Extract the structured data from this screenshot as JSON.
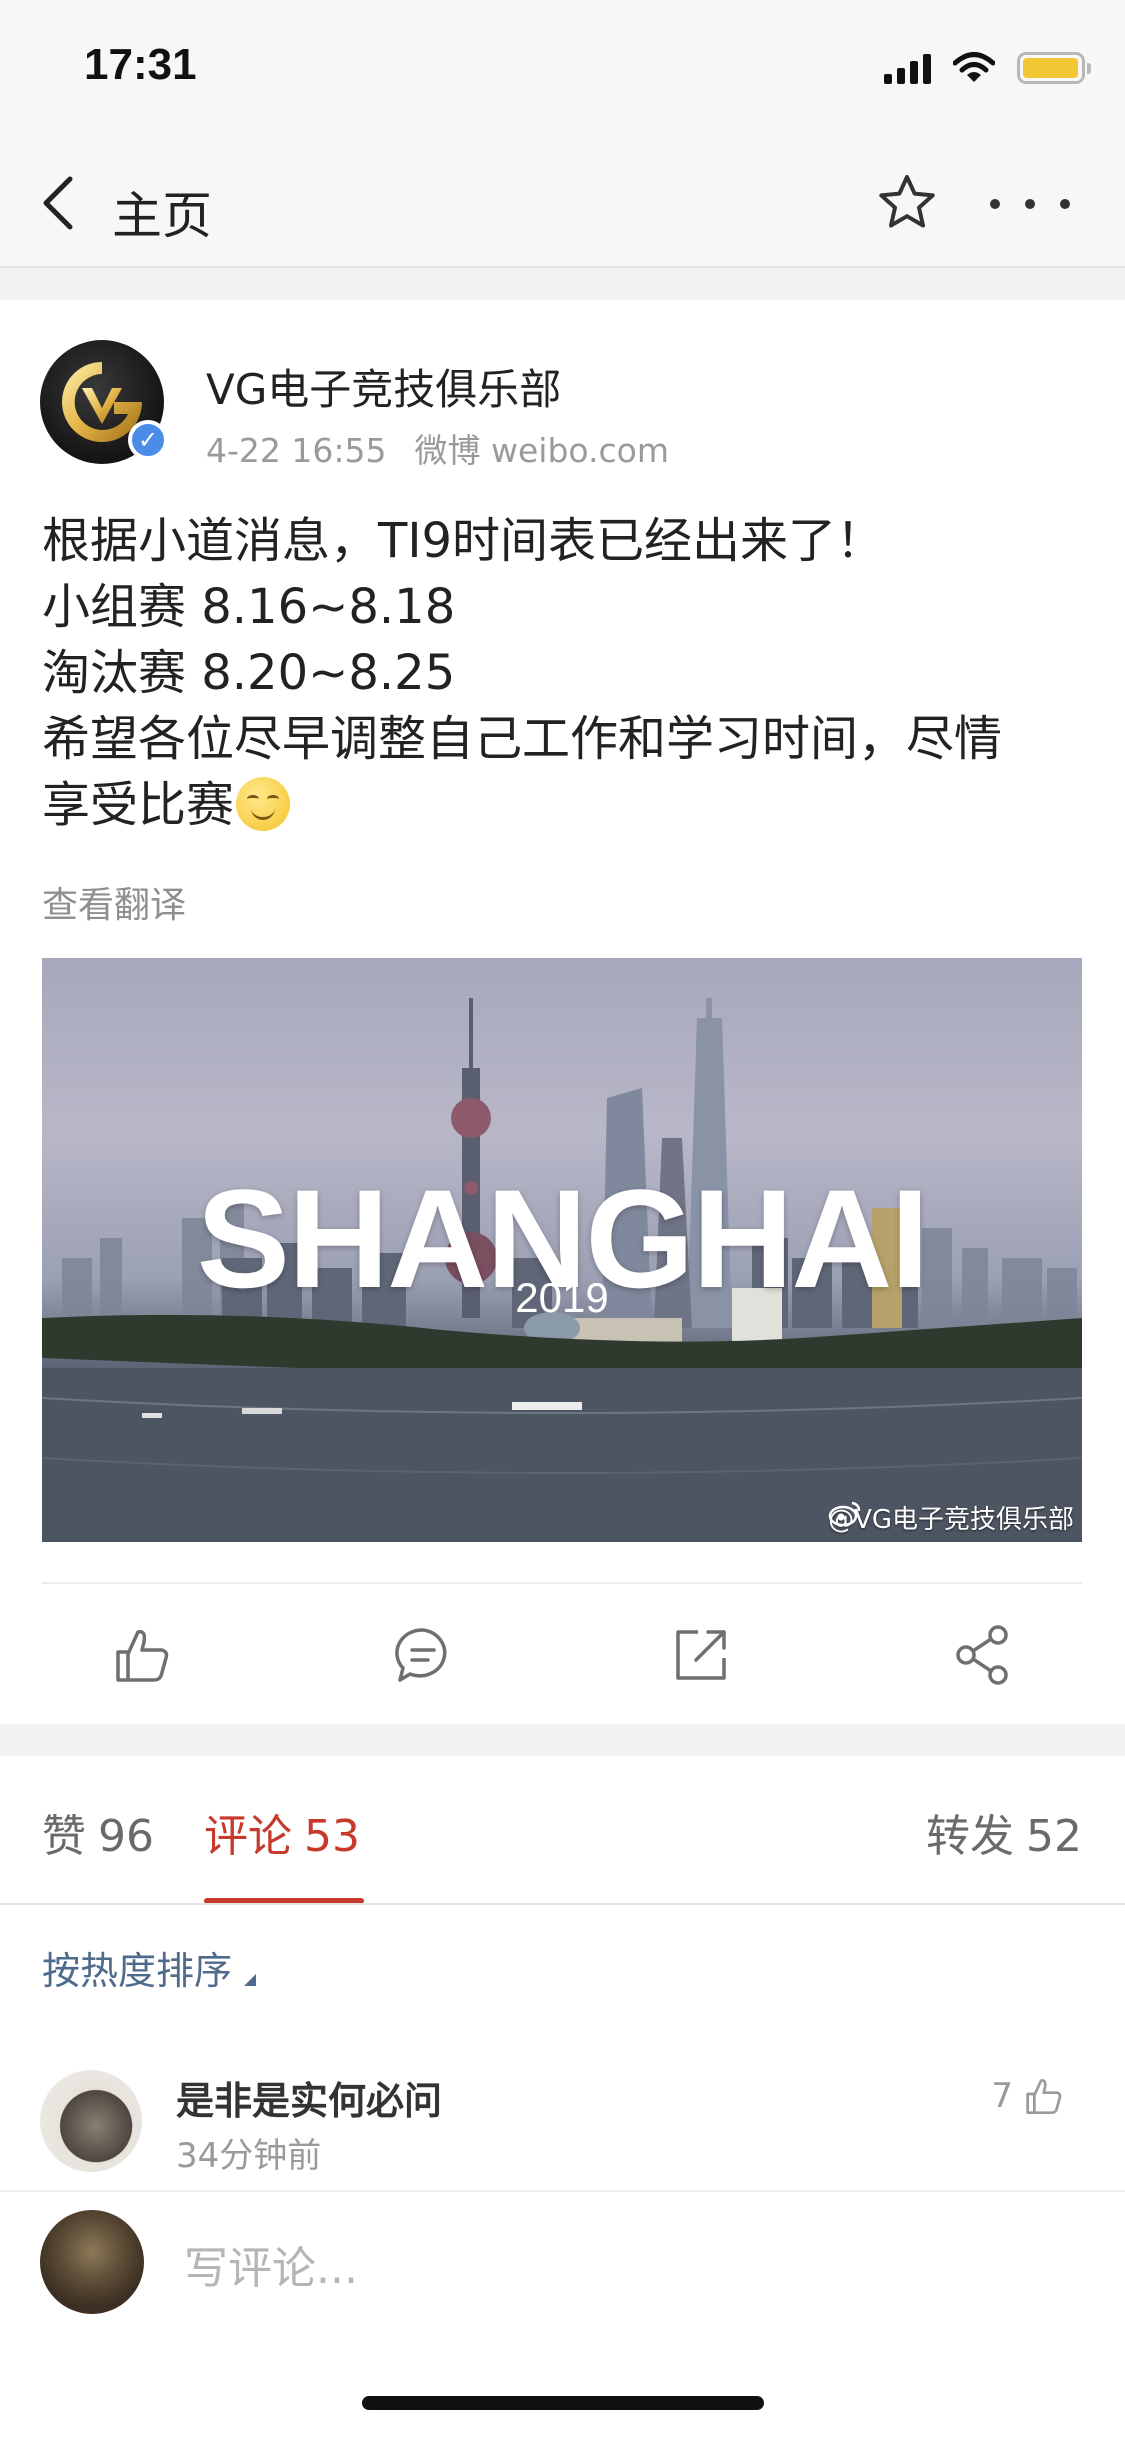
{
  "status_bar": {
    "time": "17:31"
  },
  "nav": {
    "back_label": "主页"
  },
  "post": {
    "author": "VG电子竞技俱乐部",
    "timestamp": "4-22 16:55",
    "source": "微博 weibo.com",
    "lines": [
      "根据小道消息，TI9时间表已经出来了！",
      "小组赛 8.16~8.18",
      "淘汰赛 8.20~8.25",
      "希望各位尽早调整自己工作和学习时间，尽情",
      "享受比赛"
    ],
    "translate_label": "查看翻译",
    "image": {
      "title": "SHANGHAI",
      "year": "2019",
      "watermark": "@VG电子竞技俱乐部"
    },
    "actions": [
      "like-icon",
      "comment-icon",
      "repost-icon",
      "share-icon"
    ]
  },
  "tabs": {
    "likes": {
      "label": "赞",
      "count": "96"
    },
    "comments": {
      "label": "评论",
      "count": "53"
    },
    "reposts": {
      "label": "转发",
      "count": "52"
    }
  },
  "sort_label": "按热度排序",
  "comments": [
    {
      "user": "是非是实何必问",
      "time": "34分钟前",
      "likes": "7"
    }
  ],
  "composer": {
    "placeholder": "写评论..."
  },
  "colors": {
    "accent": "#c6392b",
    "link": "#4f6b8c",
    "verified": "#4a8ce8",
    "battery": "#f2c736"
  }
}
